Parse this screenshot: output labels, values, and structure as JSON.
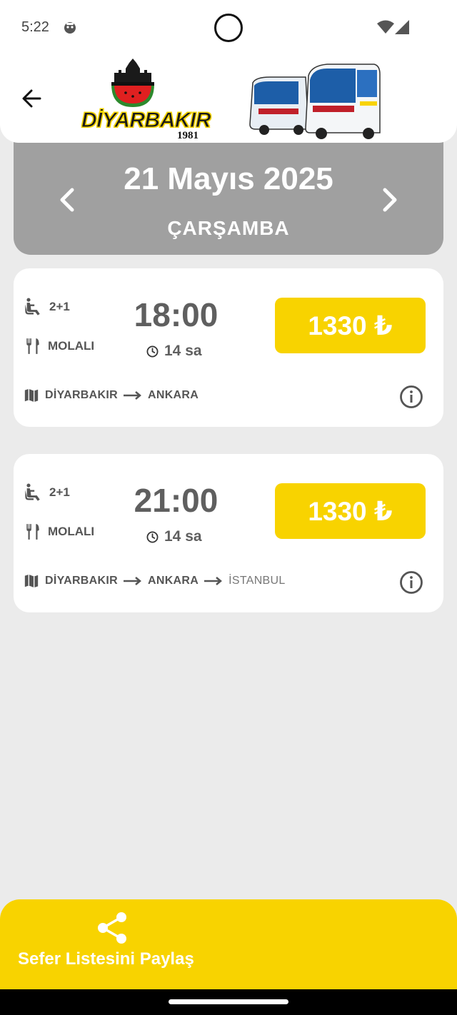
{
  "status": {
    "time": "5:22"
  },
  "header": {
    "logo_text": "DİYARBAKIR",
    "logo_year": "1981"
  },
  "date": {
    "title": "21 Mayıs 2025",
    "day": "ÇARŞAMBA"
  },
  "trips": [
    {
      "seat_layout": "2+1",
      "meal": "MOLALI",
      "time": "18:00",
      "duration": "14 sa",
      "price": "1330 ₺",
      "route": [
        "DİYARBAKIR",
        "ANKARA"
      ]
    },
    {
      "seat_layout": "2+1",
      "meal": "MOLALI",
      "time": "21:00",
      "duration": "14 sa",
      "price": "1330 ₺",
      "route": [
        "DİYARBAKIR",
        "ANKARA",
        "İSTANBUL"
      ]
    }
  ],
  "share": {
    "label": "Sefer Listesini Paylaş"
  },
  "colors": {
    "accent_yellow": "#f8d300",
    "date_panel_gray": "#a0a0a0",
    "background": "#ebebeb"
  }
}
